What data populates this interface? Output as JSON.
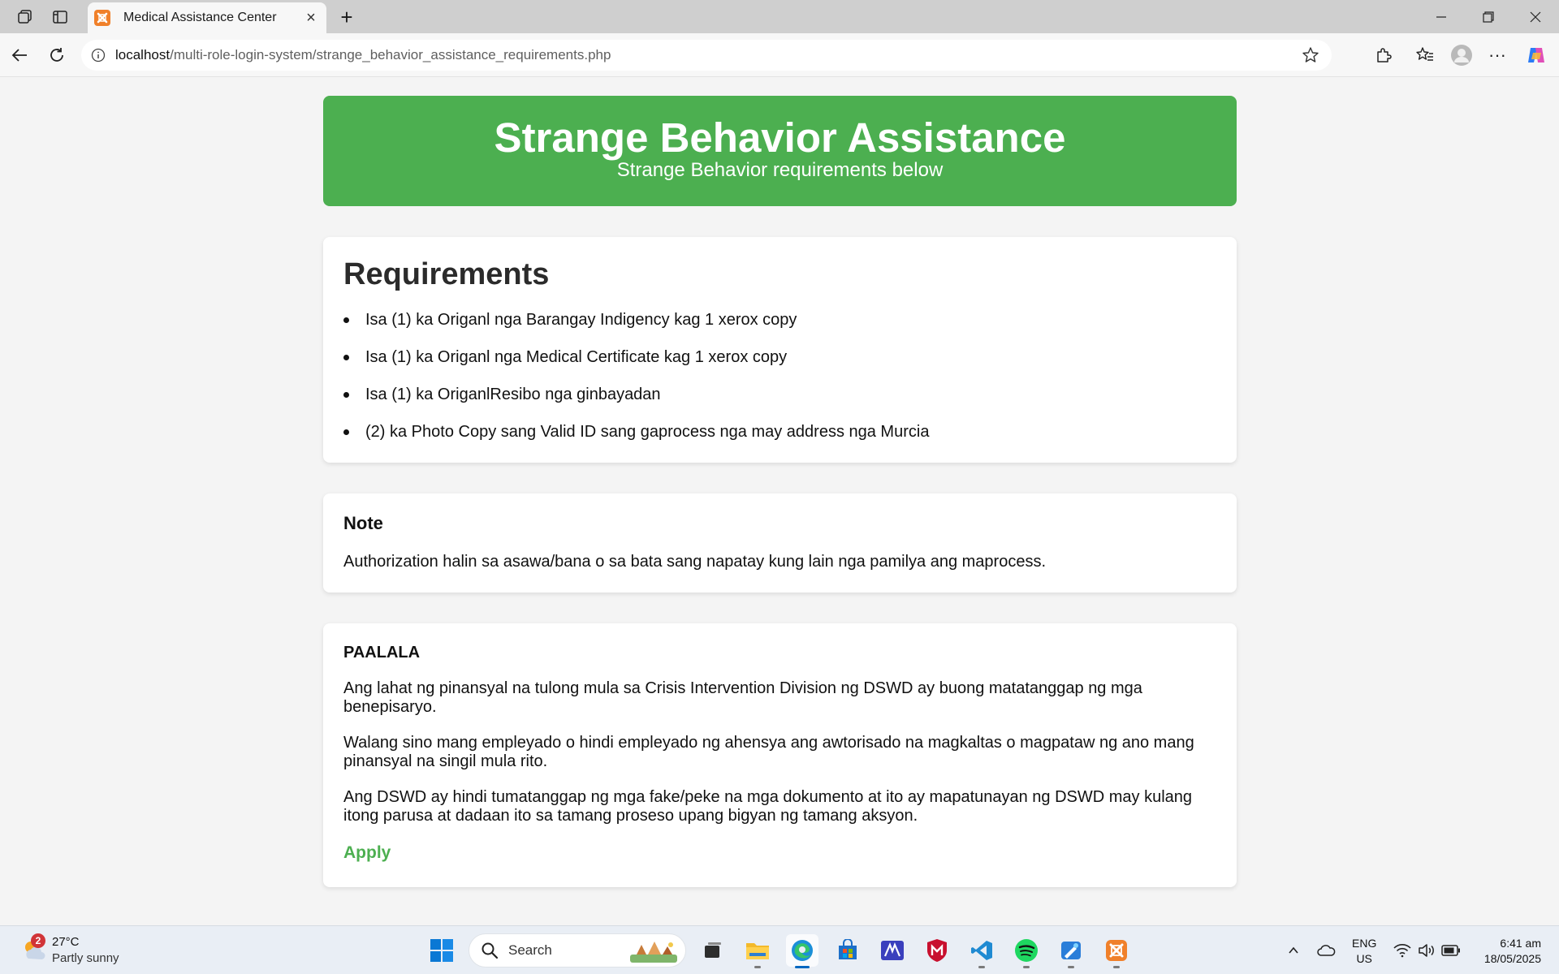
{
  "browser": {
    "tab_title": "Medical Assistance Center",
    "url_host": "localhost",
    "url_path": "/multi-role-login-system/strange_behavior_assistance_requirements.php"
  },
  "header": {
    "title": "Strange Behavior Assistance",
    "subtitle": "Strange Behavior requirements below"
  },
  "requirements": {
    "heading": "Requirements",
    "items": [
      "Isa (1) ka Origanl nga Barangay Indigency kag 1 xerox copy",
      "Isa (1) ka Origanl nga Medical Certificate kag 1 xerox copy",
      "Isa (1) ka OriganlResibo nga ginbayadan",
      "(2) ka Photo Copy sang Valid ID sang gaprocess nga may address nga Murcia"
    ]
  },
  "note": {
    "heading": "Note",
    "text": "Authorization halin sa asawa/bana o sa bata sang napatay kung lain nga pamilya ang maprocess."
  },
  "paalala": {
    "heading": "PAALALA",
    "paragraphs": [
      "Ang lahat ng pinansyal na tulong mula sa Crisis Intervention Division ng DSWD ay buong matatanggap ng mga benepisaryo.",
      "Walang sino mang empleyado o hindi empleyado ng ahensya ang awtorisado na magkaltas o magpataw ng ano mang pinansyal na singil mula rito.",
      "Ang DSWD ay hindi tumatanggap ng mga fake/peke na mga dokumento at ito ay mapatunayan ng DSWD may kulang itong parusa at dadaan ito sa tamang proseso upang bigyan ng tamang aksyon."
    ],
    "apply_label": "Apply"
  },
  "taskbar": {
    "weather_badge": "2",
    "weather_temp": "27°C",
    "weather_condition": "Partly sunny",
    "search_label": "Search",
    "lang_top": "ENG",
    "lang_bottom": "US",
    "time": "6:41 am",
    "date": "18/05/2025"
  },
  "colors": {
    "accent_green": "#4caf50",
    "page_background": "#f4f4f4"
  }
}
